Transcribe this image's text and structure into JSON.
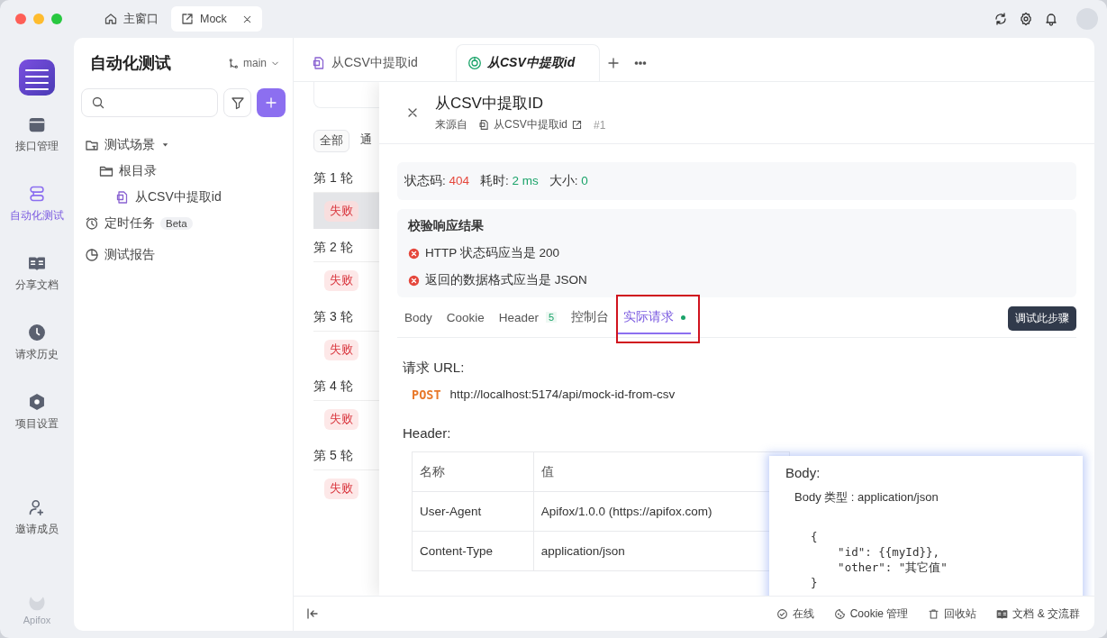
{
  "window": {
    "tabs": [
      {
        "label": "主窗口",
        "kind": "home",
        "selected": false
      },
      {
        "label": "Mock",
        "kind": "mock",
        "selected": true
      }
    ]
  },
  "rail": {
    "items": [
      {
        "label": "接口管理",
        "kind": "api",
        "selected": false
      },
      {
        "label": "自动化测试",
        "kind": "auto",
        "selected": true
      },
      {
        "label": "分享文档",
        "kind": "docs",
        "selected": false
      },
      {
        "label": "请求历史",
        "kind": "history",
        "selected": false
      },
      {
        "label": "项目设置",
        "kind": "settings",
        "selected": false
      },
      {
        "label": "邀请成员",
        "kind": "invite",
        "selected": false
      }
    ],
    "brand": "Apifox"
  },
  "sidebar": {
    "title": "自动化测试",
    "branch": "main",
    "tree": [
      {
        "label": "测试场景",
        "kind": "scenes",
        "expanded": true,
        "children": [
          {
            "label": "根目录",
            "kind": "folder",
            "children": [
              {
                "label": "从CSV中提取id",
                "kind": "case"
              }
            ]
          }
        ]
      },
      {
        "label": "定时任务",
        "kind": "schedule",
        "badge": "Beta"
      },
      {
        "label": "测试报告",
        "kind": "report"
      }
    ]
  },
  "editor_tabs": [
    {
      "label": "从CSV中提取id",
      "kind": "case",
      "selected": false
    },
    {
      "label": "从CSV中提取id",
      "kind": "run",
      "selected": true
    }
  ],
  "rounds": {
    "filters": [
      {
        "label": "全部",
        "selected": true
      },
      {
        "label": "通",
        "selected": false
      }
    ],
    "items": [
      {
        "label": "第 1 轮",
        "status": "失败",
        "selected": true
      },
      {
        "label": "第 2 轮",
        "status": "失败",
        "selected": false
      },
      {
        "label": "第 3 轮",
        "status": "失败",
        "selected": false
      },
      {
        "label": "第 4 轮",
        "status": "失败",
        "selected": false
      },
      {
        "label": "第 5 轮",
        "status": "失败",
        "selected": false
      }
    ]
  },
  "drawer": {
    "title": "从CSV中提取ID",
    "source_label": "来源自",
    "source_link": "从CSV中提取id",
    "run_number": "#1",
    "summary": [
      {
        "label": "状态码:",
        "value": "404",
        "color": "#e5483d"
      },
      {
        "label": "耗时:",
        "value": "2 ms",
        "color": "#1aa369"
      },
      {
        "label": "大小:",
        "value": "0",
        "color": "#1aa369"
      }
    ],
    "assertions": {
      "title": "校验响应结果",
      "items": [
        {
          "text": "HTTP 状态码应当是 200",
          "passed": false
        },
        {
          "text": "返回的数据格式应当是 JSON",
          "passed": false
        }
      ]
    },
    "tabs": [
      {
        "label": "Body",
        "selected": false
      },
      {
        "label": "Cookie",
        "selected": false
      },
      {
        "label": "Header",
        "count": "5",
        "selected": false
      },
      {
        "label": "控制台",
        "selected": false
      },
      {
        "label": "实际请求",
        "dot": true,
        "highlighted": true,
        "selected": true
      }
    ],
    "debug_button": "调试此步骤",
    "request": {
      "url_heading": "请求 URL:",
      "method": "POST",
      "url": "http://localhost:5174/api/mock-id-from-csv",
      "header_heading": "Header:",
      "columns": [
        "名称",
        "值"
      ],
      "rows": [
        [
          "User-Agent",
          "Apifox/1.0.0 (https://apifox.com)"
        ],
        [
          "Content-Type",
          "application/json"
        ]
      ]
    }
  },
  "popover": {
    "heading": "Body:",
    "type_line": "Body 类型 : application/json",
    "code": [
      "{",
      "    \"id\": {{myId}},",
      "    \"other\": \"其它值\"",
      "}"
    ]
  },
  "status_bar": [
    {
      "label": "在线",
      "kind": "online"
    },
    {
      "label": "Cookie 管理",
      "kind": "cookie"
    },
    {
      "label": "回收站",
      "kind": "trash"
    },
    {
      "label": "文档 & 交流群",
      "kind": "docs"
    }
  ]
}
